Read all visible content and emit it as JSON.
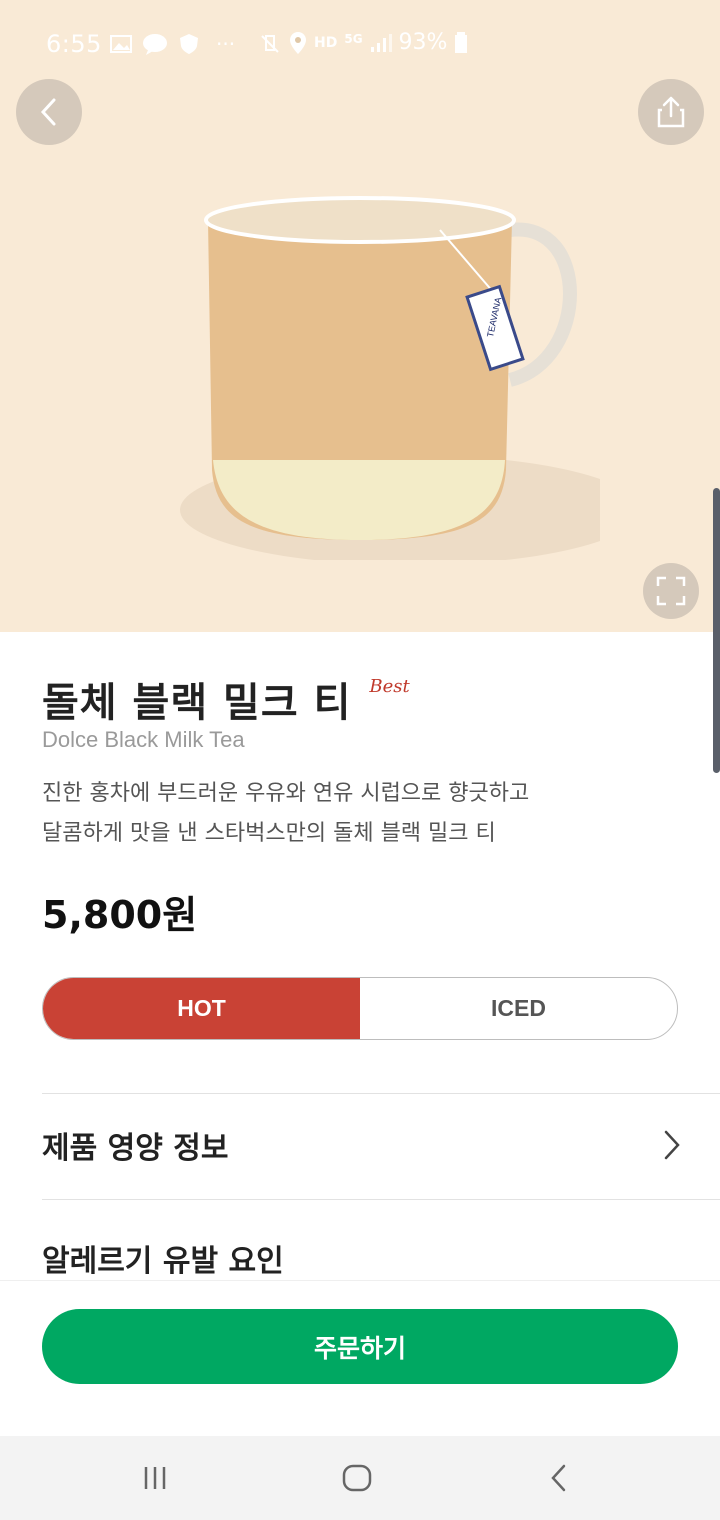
{
  "status_bar": {
    "time": "6:55",
    "network": "HD",
    "signal": "5G",
    "battery": "93%"
  },
  "product": {
    "name_ko": "돌체 블랙 밀크 티",
    "badge": "Best",
    "name_en": "Dolce Black Milk Tea",
    "description_line1": "진한 홍차에 부드러운 우유와 연유 시럽으로 향긋하고",
    "description_line2": "달콤하게 맛을 낸 스타벅스만의 돌체 블랙 밀크 티",
    "price": "5,800원",
    "tag_label": "TEAVANA"
  },
  "temperature_toggle": {
    "options": [
      "HOT",
      "ICED"
    ],
    "selected": "HOT"
  },
  "sections": {
    "nutrition": "제품 영양 정보",
    "allergy": "알레르기 유발 요인"
  },
  "order_button": "주문하기",
  "colors": {
    "hero_bg": "#f9ead6",
    "hot_red": "#c94235",
    "order_green": "#00a862"
  }
}
